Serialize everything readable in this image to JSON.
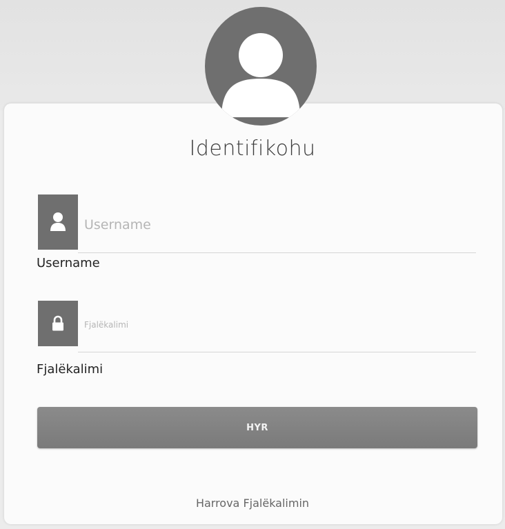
{
  "login": {
    "title": "Identifikohu",
    "username": {
      "placeholder": "Username",
      "label": "Username",
      "value": ""
    },
    "password": {
      "placeholder": "Fjalëkalimi",
      "label": "Fjalëkalimi",
      "value": ""
    },
    "submit_label": "HYR",
    "forgot_link": "Harrova Fjalëkalimin"
  },
  "icons": {
    "avatar": "user-avatar-icon",
    "username": "user-icon",
    "password": "lock-icon"
  },
  "colors": {
    "icon_background": "#6f6f6f",
    "button_background": "#828282",
    "card_background": "#fbfbfb",
    "page_background": "#ececec"
  }
}
